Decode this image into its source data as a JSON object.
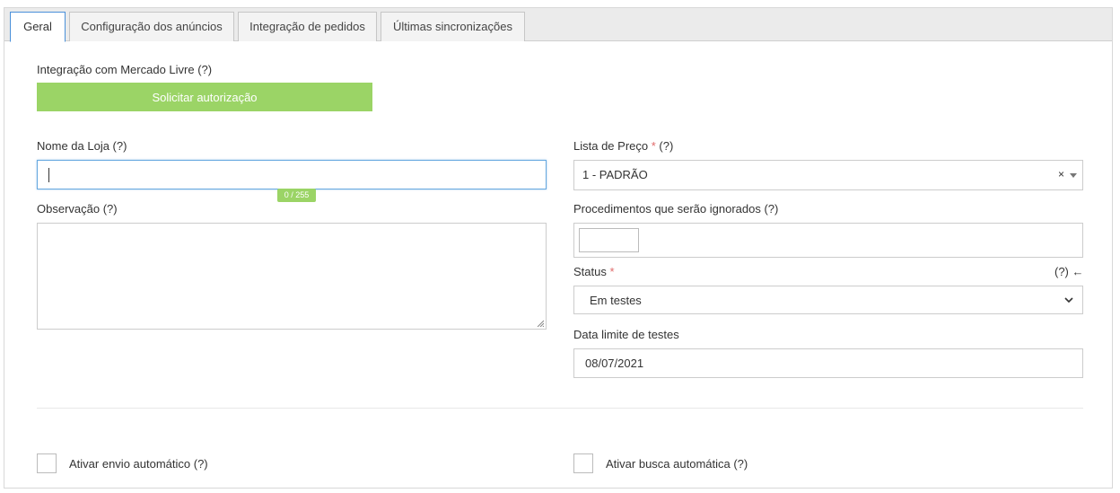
{
  "tabs": [
    {
      "label": "Geral",
      "active": true
    },
    {
      "label": "Configuração dos anúncios",
      "active": false
    },
    {
      "label": "Integração de pedidos",
      "active": false
    },
    {
      "label": "Últimas sincronizações",
      "active": false
    }
  ],
  "integration": {
    "label": "Integração com Mercado Livre (?)",
    "button_label": "Solicitar autorização"
  },
  "store_name": {
    "label": "Nome da Loja (?)",
    "value": "",
    "counter": "0 / 255"
  },
  "observation": {
    "label": "Observação (?)",
    "value": ""
  },
  "price_list": {
    "label": "Lista de Preço",
    "required_mark": "*",
    "help": "(?)",
    "value": "1 - PADRÃO",
    "clear": "×"
  },
  "ignored_procedures": {
    "label": "Procedimentos que serão ignorados (?)"
  },
  "status": {
    "label": "Status",
    "required_mark": "*",
    "help": "(?) ←",
    "value": "Em testes"
  },
  "test_deadline": {
    "label": "Data limite de testes",
    "value": "08/07/2021"
  },
  "auto_send": {
    "label": "Ativar envio automático (?)",
    "checked": false
  },
  "auto_fetch": {
    "label": "Ativar busca automática (?)",
    "checked": false
  },
  "colors": {
    "accent_green": "#9bd466",
    "active_tab_border": "#4a90d9",
    "required": "#e06a6a"
  }
}
